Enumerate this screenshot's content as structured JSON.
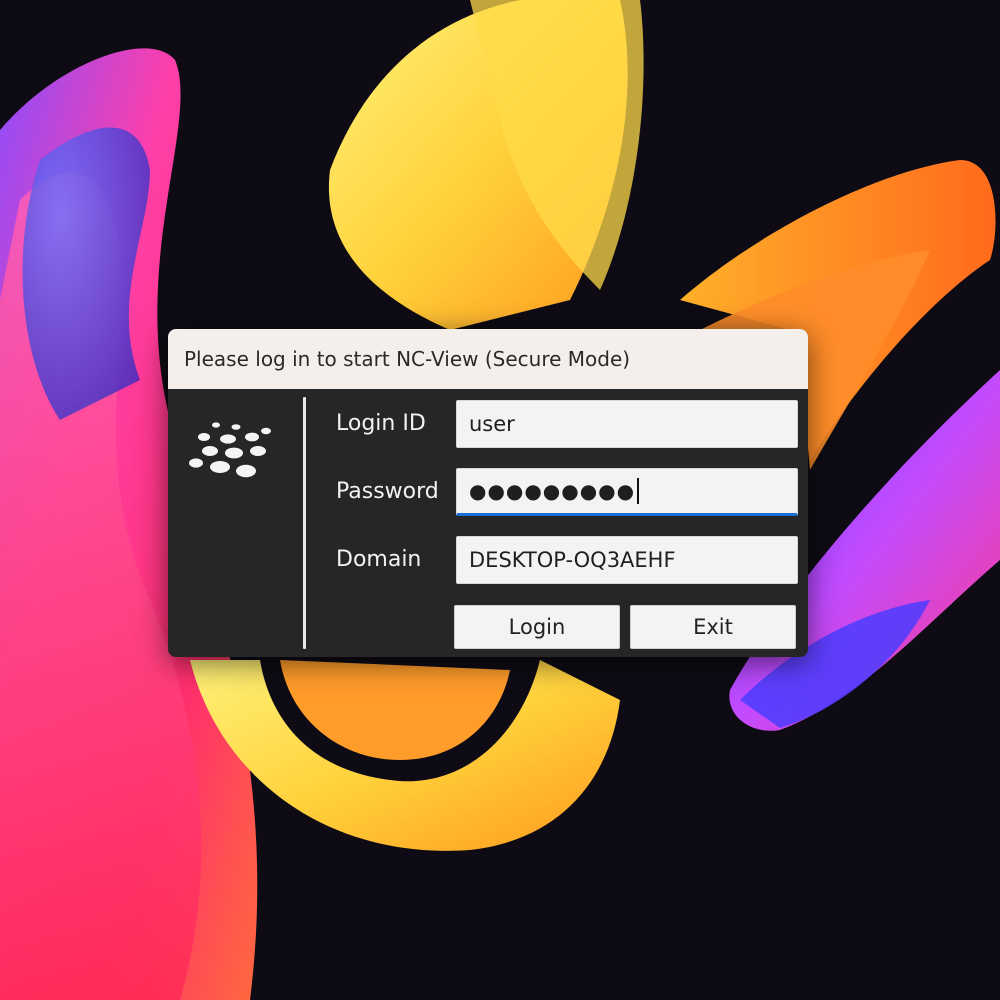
{
  "dialog": {
    "title": "Please log in to start NC-View (Secure Mode)",
    "logo_icon": "dotted-brand-logo-icon",
    "fields": {
      "login_id": {
        "label": "Login ID",
        "value": "user"
      },
      "password": {
        "label": "Password",
        "masked_value": "●●●●●●●●●"
      },
      "domain": {
        "label": "Domain",
        "value": "DESKTOP-OQ3AEHF"
      }
    },
    "buttons": {
      "login": "Login",
      "exit": "Exit"
    },
    "colors": {
      "focus_accent": "#1c6fd6",
      "panel_background": "#262626",
      "titlebar_background": "#f5efec"
    }
  }
}
